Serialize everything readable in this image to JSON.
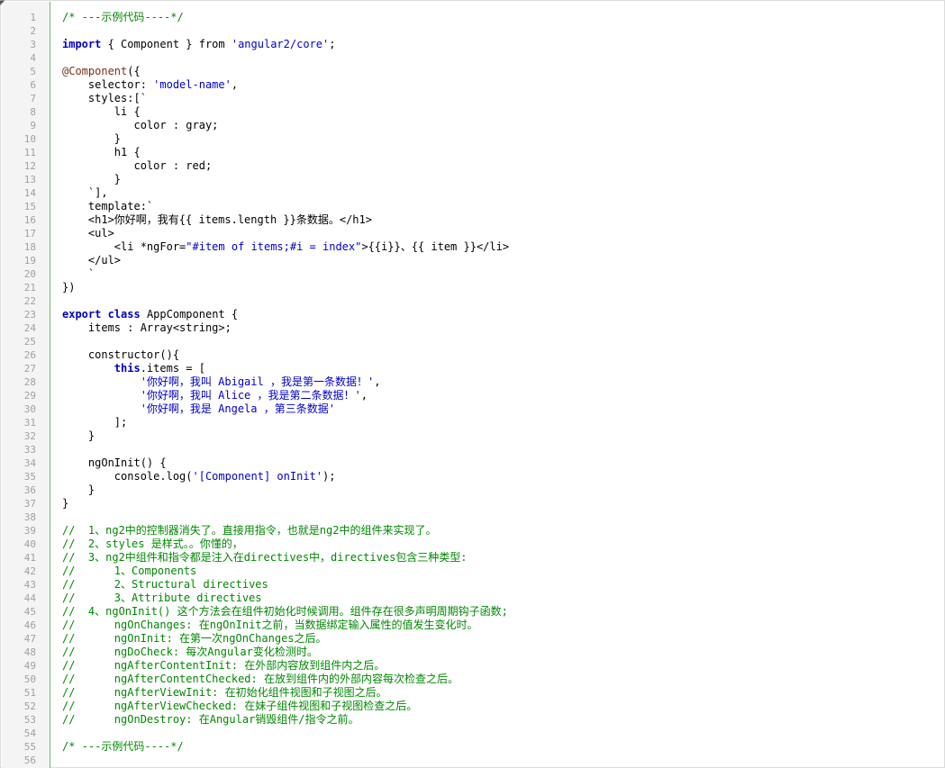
{
  "editor": {
    "lines": [
      {
        "n": "1",
        "t": [
          {
            "c": "cm",
            "s": "/* ---示例代码----*/"
          }
        ]
      },
      {
        "n": "2",
        "t": []
      },
      {
        "n": "3",
        "t": [
          {
            "c": "kw",
            "s": "import"
          },
          {
            "c": "",
            "s": " { Component } from "
          },
          {
            "c": "str",
            "s": "'angular2/core'"
          },
          {
            "c": "",
            "s": ";"
          }
        ]
      },
      {
        "n": "4",
        "t": []
      },
      {
        "n": "5",
        "t": [
          {
            "c": "at",
            "s": "@Component"
          },
          {
            "c": "",
            "s": "({"
          }
        ]
      },
      {
        "n": "6",
        "t": [
          {
            "c": "",
            "s": "    selector: "
          },
          {
            "c": "str",
            "s": "'model-name'"
          },
          {
            "c": "",
            "s": ","
          }
        ]
      },
      {
        "n": "7",
        "t": [
          {
            "c": "",
            "s": "    styles:[`"
          }
        ]
      },
      {
        "n": "8",
        "t": [
          {
            "c": "",
            "s": "        li {"
          }
        ]
      },
      {
        "n": "9",
        "t": [
          {
            "c": "",
            "s": "           color : gray;"
          }
        ]
      },
      {
        "n": "10",
        "t": [
          {
            "c": "",
            "s": "        }"
          }
        ]
      },
      {
        "n": "11",
        "t": [
          {
            "c": "",
            "s": "        h1 {"
          }
        ]
      },
      {
        "n": "12",
        "t": [
          {
            "c": "",
            "s": "           color : red;"
          }
        ]
      },
      {
        "n": "13",
        "t": [
          {
            "c": "",
            "s": "        }"
          }
        ]
      },
      {
        "n": "14",
        "t": [
          {
            "c": "",
            "s": "    `],"
          }
        ]
      },
      {
        "n": "15",
        "t": [
          {
            "c": "",
            "s": "    template:`"
          }
        ]
      },
      {
        "n": "16",
        "t": [
          {
            "c": "",
            "s": "    <h1>你好啊，我有{{ items.length }}条数据。</h1>"
          }
        ]
      },
      {
        "n": "17",
        "t": [
          {
            "c": "",
            "s": "    <ul>"
          }
        ]
      },
      {
        "n": "18",
        "t": [
          {
            "c": "",
            "s": "        <li *ngFor="
          },
          {
            "c": "str",
            "s": "\"#item of items;#i = index\""
          },
          {
            "c": "",
            "s": ">{{i}}、{{ item }}</li>"
          }
        ]
      },
      {
        "n": "19",
        "t": [
          {
            "c": "",
            "s": "    </ul>"
          }
        ]
      },
      {
        "n": "20",
        "t": [
          {
            "c": "",
            "s": "    `"
          }
        ]
      },
      {
        "n": "21",
        "t": [
          {
            "c": "",
            "s": "})"
          }
        ]
      },
      {
        "n": "22",
        "t": []
      },
      {
        "n": "23",
        "t": [
          {
            "c": "kw",
            "s": "export"
          },
          {
            "c": "",
            "s": " "
          },
          {
            "c": "kw",
            "s": "class"
          },
          {
            "c": "",
            "s": " AppComponent {"
          }
        ]
      },
      {
        "n": "24",
        "t": [
          {
            "c": "",
            "s": "    items : Array<string>;"
          }
        ]
      },
      {
        "n": "25",
        "t": []
      },
      {
        "n": "26",
        "t": [
          {
            "c": "",
            "s": "    constructor(){"
          }
        ]
      },
      {
        "n": "27",
        "t": [
          {
            "c": "",
            "s": "        "
          },
          {
            "c": "kw",
            "s": "this"
          },
          {
            "c": "",
            "s": ".items = ["
          }
        ]
      },
      {
        "n": "28",
        "t": [
          {
            "c": "",
            "s": "            "
          },
          {
            "c": "str",
            "s": "'你好啊，我叫 Abigail ，我是第一条数据！'"
          },
          {
            "c": "",
            "s": ","
          }
        ]
      },
      {
        "n": "29",
        "t": [
          {
            "c": "",
            "s": "            "
          },
          {
            "c": "str",
            "s": "'你好啊，我叫 Alice ，我是第二条数据！'"
          },
          {
            "c": "",
            "s": ","
          }
        ]
      },
      {
        "n": "30",
        "t": [
          {
            "c": "",
            "s": "            "
          },
          {
            "c": "str",
            "s": "'你好啊，我是 Angela ，第三条数据'"
          }
        ]
      },
      {
        "n": "31",
        "t": [
          {
            "c": "",
            "s": "        ];"
          }
        ]
      },
      {
        "n": "32",
        "t": [
          {
            "c": "",
            "s": "    }"
          }
        ]
      },
      {
        "n": "33",
        "t": []
      },
      {
        "n": "34",
        "t": [
          {
            "c": "",
            "s": "    ngOnInit() {"
          }
        ]
      },
      {
        "n": "35",
        "t": [
          {
            "c": "",
            "s": "        console.log("
          },
          {
            "c": "str",
            "s": "'[Component] onInit'"
          },
          {
            "c": "",
            "s": ");"
          }
        ]
      },
      {
        "n": "36",
        "t": [
          {
            "c": "",
            "s": "    }"
          }
        ]
      },
      {
        "n": "37",
        "t": [
          {
            "c": "",
            "s": "}"
          }
        ]
      },
      {
        "n": "38",
        "t": []
      },
      {
        "n": "39",
        "t": [
          {
            "c": "cm",
            "s": "//  1、ng2中的控制器消失了。直接用指令，也就是ng2中的组件来实现了。"
          }
        ]
      },
      {
        "n": "40",
        "t": [
          {
            "c": "cm",
            "s": "//  2、styles 是样式。。你懂的，"
          }
        ]
      },
      {
        "n": "41",
        "t": [
          {
            "c": "cm",
            "s": "//  3、ng2中组件和指令都是注入在directives中，directives包含三种类型:"
          }
        ]
      },
      {
        "n": "42",
        "t": [
          {
            "c": "cm",
            "s": "//      1、Components"
          }
        ]
      },
      {
        "n": "43",
        "t": [
          {
            "c": "cm",
            "s": "//      2、Structural directives"
          }
        ]
      },
      {
        "n": "44",
        "t": [
          {
            "c": "cm",
            "s": "//      3、Attribute directives"
          }
        ]
      },
      {
        "n": "45",
        "t": [
          {
            "c": "cm",
            "s": "//  4、ngOnInit() 这个方法会在组件初始化时候调用。组件存在很多声明周期钩子函数;"
          }
        ]
      },
      {
        "n": "46",
        "t": [
          {
            "c": "cm",
            "s": "//      ngOnChanges: 在ngOnInit之前，当数据绑定输入属性的值发生变化时。"
          }
        ]
      },
      {
        "n": "47",
        "t": [
          {
            "c": "cm",
            "s": "//      ngOnInit: 在第一次ngOnChanges之后。"
          }
        ]
      },
      {
        "n": "48",
        "t": [
          {
            "c": "cm",
            "s": "//      ngDoCheck: 每次Angular变化检测时。"
          }
        ]
      },
      {
        "n": "49",
        "t": [
          {
            "c": "cm",
            "s": "//      ngAfterContentInit: 在外部内容放到组件内之后。"
          }
        ]
      },
      {
        "n": "50",
        "t": [
          {
            "c": "cm",
            "s": "//      ngAfterContentChecked: 在放到组件内的外部内容每次检查之后。"
          }
        ]
      },
      {
        "n": "51",
        "t": [
          {
            "c": "cm",
            "s": "//      ngAfterViewInit: 在初始化组件视图和子视图之后。"
          }
        ]
      },
      {
        "n": "52",
        "t": [
          {
            "c": "cm",
            "s": "//      ngAfterViewChecked: 在妹子组件视图和子视图检查之后。"
          }
        ]
      },
      {
        "n": "53",
        "t": [
          {
            "c": "cm",
            "s": "//      ngOnDestroy: 在Angular销毁组件/指令之前。"
          }
        ]
      },
      {
        "n": "54",
        "t": []
      },
      {
        "n": "55",
        "t": [
          {
            "c": "cm",
            "s": "/* ---示例代码----*/"
          }
        ]
      },
      {
        "n": "56",
        "t": []
      }
    ]
  }
}
